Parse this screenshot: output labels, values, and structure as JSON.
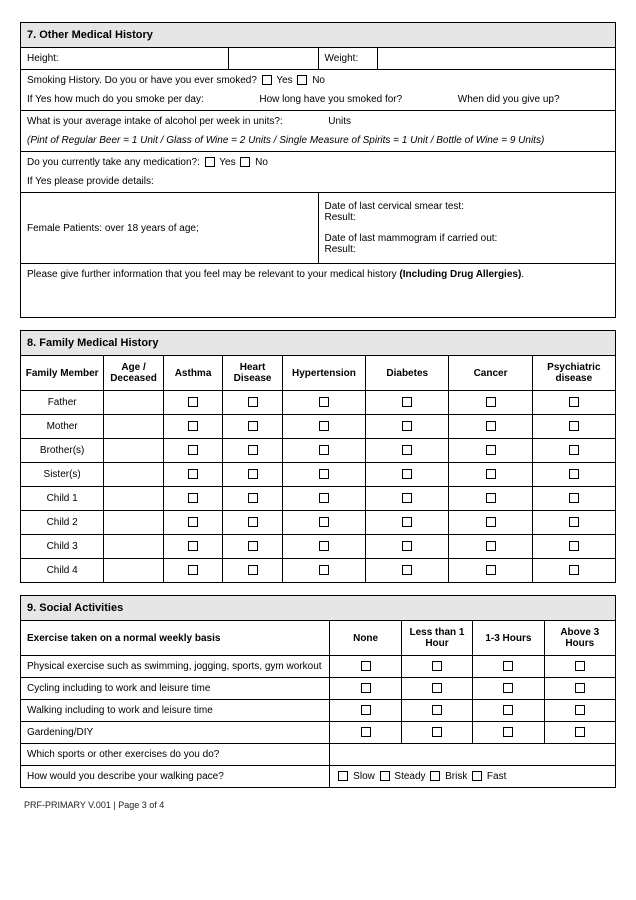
{
  "section7": {
    "title": "7. Other Medical History",
    "height_label": "Height:",
    "weight_label": "Weight:",
    "smoking_q": "Smoking History. Do you or have you ever smoked?",
    "yes": "Yes",
    "no": "No",
    "smoke_per_day": "If Yes how much do you smoke per day:",
    "smoke_how_long": "How long have you smoked for?",
    "smoke_give_up": "When did you give up?",
    "alcohol_q": "What is your average intake of alcohol per week in units?:",
    "units": "Units",
    "alcohol_note": "(Pint of Regular Beer =  1 Unit / Glass of Wine = 2 Units / Single Measure of Spirits =  1  Unit /  Bottle of Wine = 9 Units)",
    "medication_q": "Do you currently take any medication?:",
    "medication_details": "If Yes please provide details:",
    "female_label": "Female Patients: over 18 years of age;",
    "smear_label": "Date of last cervical smear test:",
    "mammogram_label": "Date of last mammogram if carried out:",
    "result": "Result:",
    "further_pre": "Please give further information that you feel may be relevant to your medical history ",
    "further_bold": "(Including Drug Allergies)",
    "further_dot": "."
  },
  "section8": {
    "title": "8. Family Medical History",
    "headers": [
      "Family Member",
      "Age / Deceased",
      "Asthma",
      "Heart Disease",
      "Hypertension",
      "Diabetes",
      "Cancer",
      "Psychiatric disease"
    ],
    "members": [
      "Father",
      "Mother",
      "Brother(s)",
      "Sister(s)",
      "Child 1",
      "Child 2",
      "Child 3",
      "Child 4"
    ]
  },
  "section9": {
    "title": "9. Social Activities",
    "exercise_head": "Exercise taken on a normal weekly basis",
    "cols": [
      "None",
      "Less than 1 Hour",
      "1-3 Hours",
      "Above 3 Hours"
    ],
    "rows": [
      "Physical exercise such as swimming, jogging, sports, gym workout",
      "Cycling including to work and leisure time",
      "Walking including to work and leisure time",
      "Gardening/DIY"
    ],
    "sports_q": "Which sports or other exercises do you do?",
    "pace_q": "How would you describe your walking pace?",
    "paces": [
      "Slow",
      "Steady",
      "Brisk",
      "Fast"
    ]
  },
  "footer": "PRF-PRIMARY V.001 | Page 3 of 4"
}
